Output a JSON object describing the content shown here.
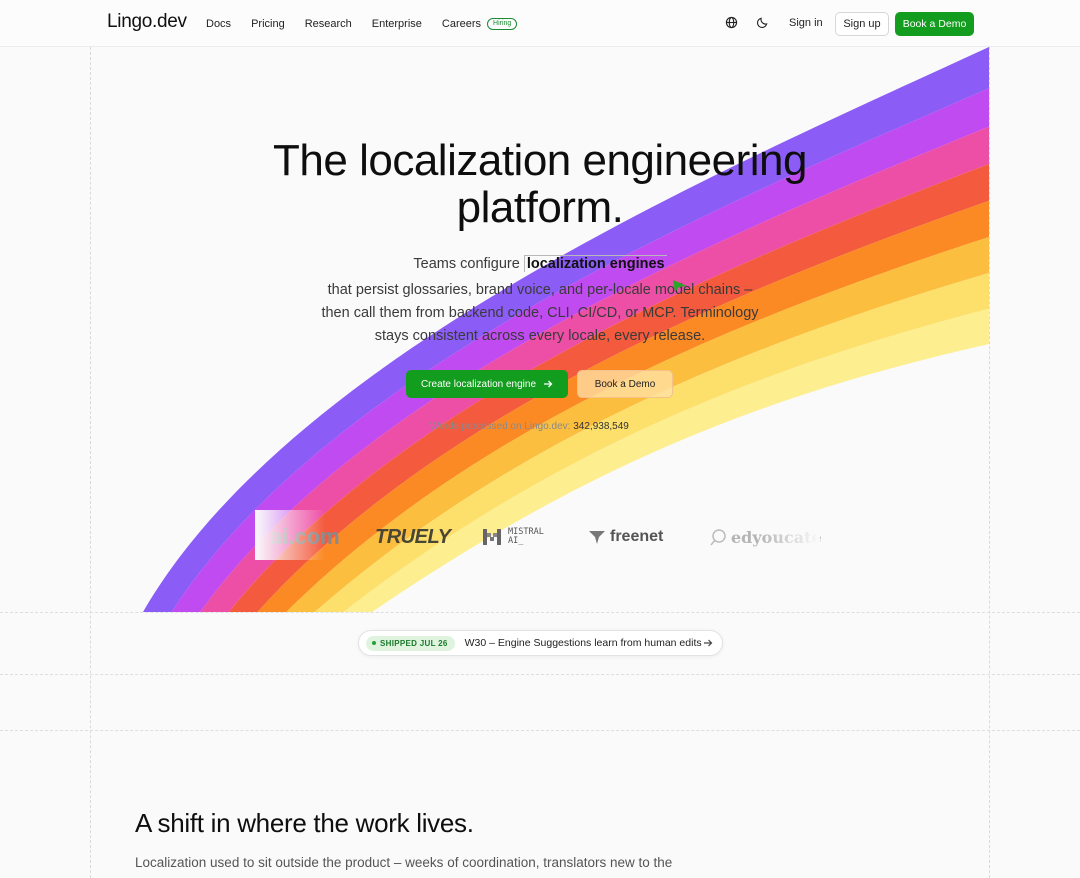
{
  "header": {
    "logo": "Lingo.dev",
    "nav": [
      {
        "label": "Docs"
      },
      {
        "label": "Pricing"
      },
      {
        "label": "Research"
      },
      {
        "label": "Enterprise"
      },
      {
        "label": "Careers",
        "badge": "Hiring"
      }
    ],
    "icons": [
      "globe-icon",
      "moon-icon"
    ],
    "signin_label": "Sign in",
    "signup_label": "Sign up",
    "demo_label": "Book a Demo"
  },
  "hero": {
    "title_line1": "The localization engineering",
    "title_line2": "platform.",
    "sub_prefix": "Teams configure",
    "sub_highlight": "localization engines",
    "sub_line2": "that persist glossaries, brand voice, and per-locale model chains –",
    "sub_line3": "then call them from backend code, CLI, CI/CD, or MCP. Terminology",
    "sub_line4": "stays consistent across every locale, every release.",
    "primary_cta": "Create localization engine",
    "secondary_cta": "Book a Demo",
    "counter_label": "Words processed on Lingo.dev:",
    "counter_value": "342,938,549"
  },
  "logos": {
    "items": [
      "ai.com",
      "TRUELY",
      "MISTRAL",
      "AI_",
      "freenet",
      "edyoucate"
    ]
  },
  "announcement": {
    "badge": "SHIPPED JUL 26",
    "text": "W30 – Engine Suggestions learn from human edits"
  },
  "section2": {
    "title": "A shift in where the work lives.",
    "body": "Localization used to sit outside the product – weeks of coordination, translators new to the brand, fixes long after release. Teams that moved it inside the product found"
  },
  "colors": {
    "brand_green": "#139d1f",
    "rainbow": [
      "#8b5cf6",
      "#c04bf0",
      "#ee4fa6",
      "#f45a3e",
      "#fb8a25",
      "#fbbe3f",
      "#fde06b",
      "#fdee8f"
    ]
  }
}
